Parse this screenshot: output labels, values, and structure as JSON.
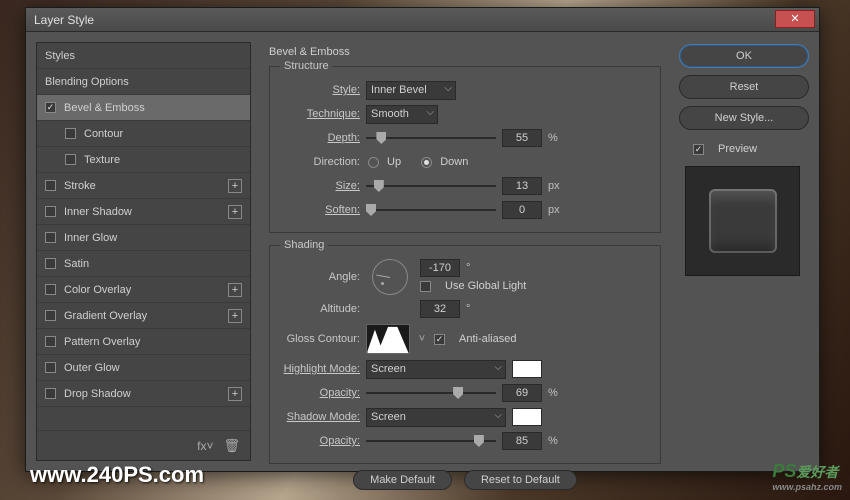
{
  "dialog_title": "Layer Style",
  "watermark_left": "www.240PS.com",
  "watermark_right_main": "PS",
  "watermark_right_cn": "爱好者",
  "watermark_right_sub": "www.psahz.com",
  "styles_list": {
    "styles": "Styles",
    "blending": "Blending Options",
    "bevel": "Bevel & Emboss",
    "contour": "Contour",
    "texture": "Texture",
    "stroke": "Stroke",
    "inner_shadow": "Inner Shadow",
    "inner_glow": "Inner Glow",
    "satin": "Satin",
    "color_overlay": "Color Overlay",
    "gradient_overlay": "Gradient Overlay",
    "pattern_overlay": "Pattern Overlay",
    "outer_glow": "Outer Glow",
    "drop_shadow": "Drop Shadow"
  },
  "section_title": "Bevel & Emboss",
  "structure": {
    "legend": "Structure",
    "style_lbl": "Style:",
    "style_val": "Inner Bevel",
    "technique_lbl": "Technique:",
    "technique_val": "Smooth",
    "depth_lbl": "Depth:",
    "depth_val": "55",
    "depth_unit": "%",
    "direction_lbl": "Direction:",
    "up": "Up",
    "down": "Down",
    "size_lbl": "Size:",
    "size_val": "13",
    "size_unit": "px",
    "soften_lbl": "Soften:",
    "soften_val": "0",
    "soften_unit": "px"
  },
  "shading": {
    "legend": "Shading",
    "angle_lbl": "Angle:",
    "angle_val": "-170",
    "global_light": "Use Global Light",
    "altitude_lbl": "Altitude:",
    "altitude_val": "32",
    "gloss_lbl": "Gloss Contour:",
    "antialiased": "Anti-aliased",
    "highlight_lbl": "Highlight Mode:",
    "highlight_val": "Screen",
    "opacity_lbl": "Opacity:",
    "hl_opacity": "69",
    "shadow_lbl": "Shadow Mode:",
    "shadow_val": "Screen",
    "sh_opacity": "85",
    "pct": "%",
    "deg": "°"
  },
  "buttons": {
    "make_default": "Make Default",
    "reset_default": "Reset to Default",
    "ok": "OK",
    "reset": "Reset",
    "new_style": "New Style...",
    "preview": "Preview"
  }
}
